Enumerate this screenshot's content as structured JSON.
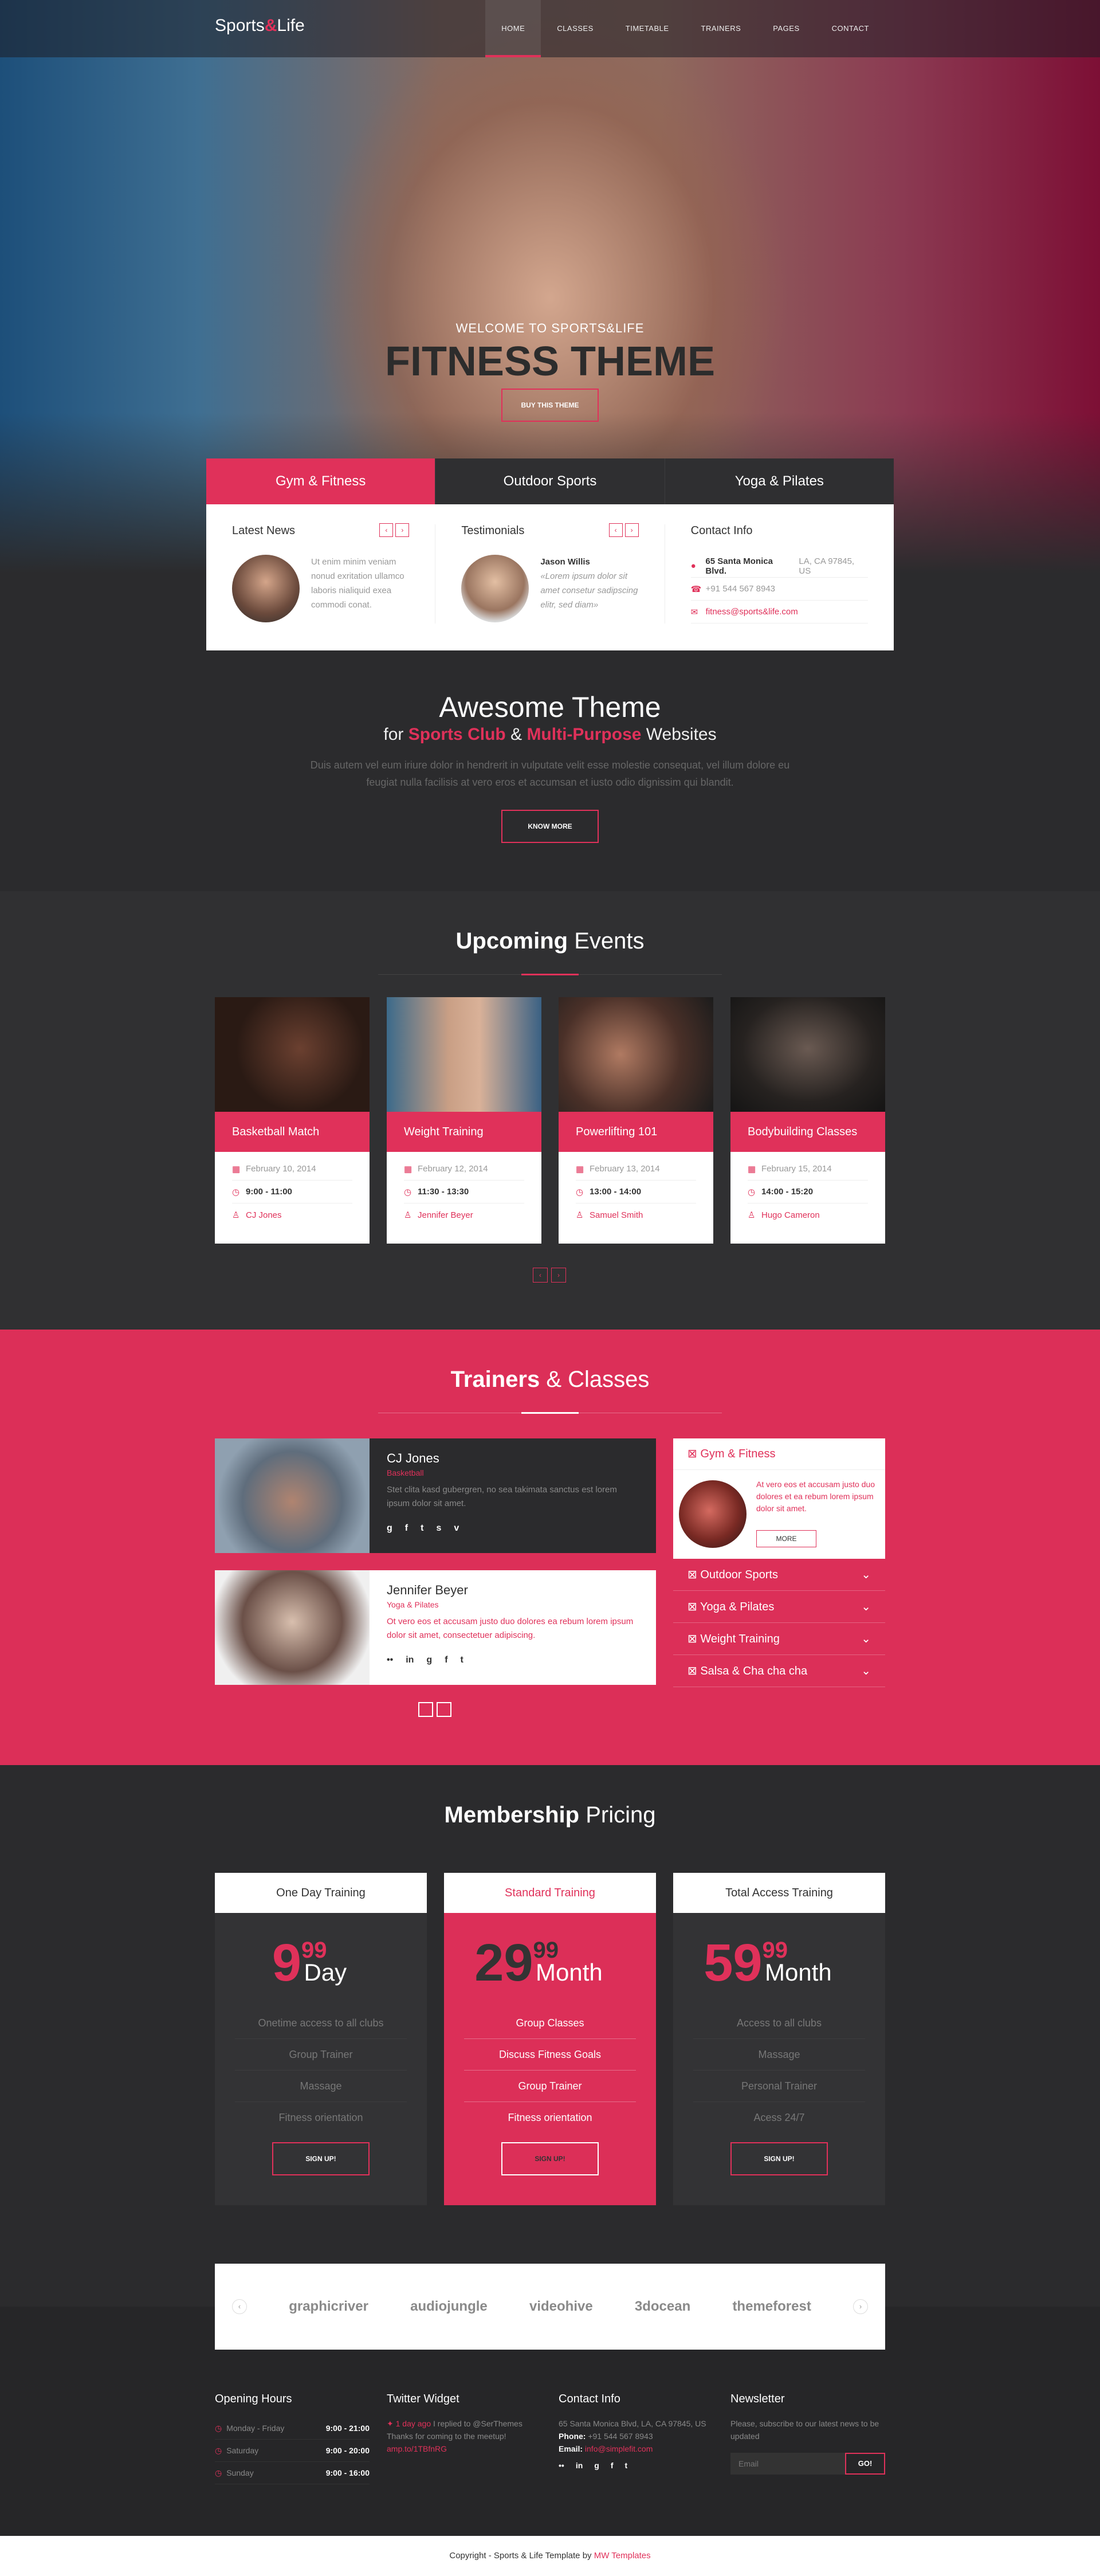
{
  "nav": {
    "logo_left": "Sports",
    "logo_amp": "&",
    "logo_right": "Life",
    "items": [
      "HOME",
      "CLASSES",
      "TIMETABLE",
      "TRAINERS",
      "PAGES",
      "CONTACT"
    ]
  },
  "hero": {
    "welcome": "WELCOME TO SPORTS&LIFE",
    "title": "FITNESS THEME",
    "button": "BUY THIS THEME"
  },
  "tabs": {
    "labels": [
      "Gym & Fitness",
      "Outdoor Sports",
      "Yoga & Pilates"
    ],
    "news": {
      "title": "Latest News",
      "text": "Ut enim minim veniam nonud exritation ullamco laboris nialiquid exea commodi conat."
    },
    "testimonials": {
      "title": "Testimonials",
      "name": "Jason Willis",
      "text": "«Lorem ipsum dolor sit amet consetur sadipscing elitr, sed diam»"
    },
    "contact": {
      "title": "Contact Info",
      "address_bold": "65 Santa Monica Blvd.",
      "address_rest": "LA, CA 97845, US",
      "phone": "+91 544 567 8943",
      "email": "fitness@sports&life.com"
    }
  },
  "awesome": {
    "title": "Awesome Theme",
    "sub_for": "for",
    "sub_a": "Sports Club",
    "sub_and": "&",
    "sub_b": "Multi-Purpose",
    "sub_end": "Websites",
    "text": "Duis autem vel eum iriure dolor in hendrerit in vulputate velit esse molestie consequat, vel illum dolore eu feugiat nulla facilisis at vero eros et accumsan et iusto odio dignissim qui blandit.",
    "button": "KNOW MORE"
  },
  "events": {
    "title_bold": "Upcoming",
    "title_light": "Events",
    "cards": [
      {
        "name": "Basketball Match",
        "date": "February 10, 2014",
        "time": "9:00 - 11:00",
        "trainer": "CJ Jones"
      },
      {
        "name": "Weight Training",
        "date": "February 12, 2014",
        "time": "11:30 - 13:30",
        "trainer": "Jennifer Beyer"
      },
      {
        "name": "Powerlifting 101",
        "date": "February 13, 2014",
        "time": "13:00 - 14:00",
        "trainer": "Samuel Smith"
      },
      {
        "name": "Bodybuilding Classes",
        "date": "February 15, 2014",
        "time": "14:00 - 15:20",
        "trainer": "Hugo Cameron"
      }
    ]
  },
  "trainers": {
    "title_bold": "Trainers",
    "title_light": "& Classes",
    "list": [
      {
        "name": "CJ Jones",
        "role": "Basketball",
        "desc": "Stet clita kasd gubergren, no sea takimata sanctus est lorem ipsum dolor sit amet."
      },
      {
        "name": "Jennifer Beyer",
        "role": "Yoga & Pilates",
        "desc": "Ot vero eos et accusam justo duo dolores ea rebum lorem ipsum dolor sit amet, consectetuer adipiscing."
      }
    ],
    "accordion": {
      "open": "Gym & Fitness",
      "open_text": "At vero eos et accusam justo duo dolores et ea rebum lorem ipsum dolor sit amet.",
      "more": "MORE",
      "items": [
        "Outdoor Sports",
        "Yoga & Pilates",
        "Weight Training",
        "Salsa & Cha cha cha"
      ]
    }
  },
  "pricing": {
    "title_bold": "Membership",
    "title_light": "Pricing",
    "plans": [
      {
        "name": "One Day Training",
        "price": "9",
        "cents": "99",
        "per": "Day",
        "features": [
          "Onetime access to all clubs",
          "Group Trainer",
          "Massage",
          "Fitness orientation"
        ],
        "button": "SIGN UP!"
      },
      {
        "name": "Standard Training",
        "price": "29",
        "cents": "99",
        "per": "Month",
        "features": [
          "Group Classes",
          "Discuss Fitness Goals",
          "Group Trainer",
          "Fitness orientation"
        ],
        "button": "SIGN UP!"
      },
      {
        "name": "Total Access Training",
        "price": "59",
        "cents": "99",
        "per": "Month",
        "features": [
          "Access to all clubs",
          "Massage",
          "Personal Trainer",
          "Acess 24/7"
        ],
        "button": "SIGN UP!"
      }
    ]
  },
  "clients": [
    "graphicriver",
    "audiojungle",
    "videohive",
    "3docean",
    "themeforest"
  ],
  "footer": {
    "hours": {
      "title": "Opening Hours",
      "rows": [
        {
          "day": "Monday - Friday",
          "time": "9:00 - 21:00"
        },
        {
          "day": "Saturday",
          "time": "9:00 - 20:00"
        },
        {
          "day": "Sunday",
          "time": "9:00 - 16:00"
        }
      ]
    },
    "twitter": {
      "title": "Twitter Widget",
      "time": "1 day ago",
      "text": "I replied to @SerThemes Thanks for coming to the meetup!",
      "link": "amp.to/1TBfnRG"
    },
    "contact": {
      "title": "Contact Info",
      "address": "65 Santa Monica Blvd, LA, CA 97845, US",
      "phone_label": "Phone:",
      "phone": "+91 544 567 8943",
      "email_label": "Email:",
      "email": "info@simplefit.com"
    },
    "newsletter": {
      "title": "Newsletter",
      "text": "Please, subscribe to our latest news to be updated",
      "placeholder": "Email",
      "button": "GO!"
    }
  },
  "copyright": {
    "text": "Copyright - Sports & Life Template by",
    "link": "MW Templates"
  },
  "colors": {
    "accent": "#e0315a",
    "dark": "#2b2b2d"
  }
}
